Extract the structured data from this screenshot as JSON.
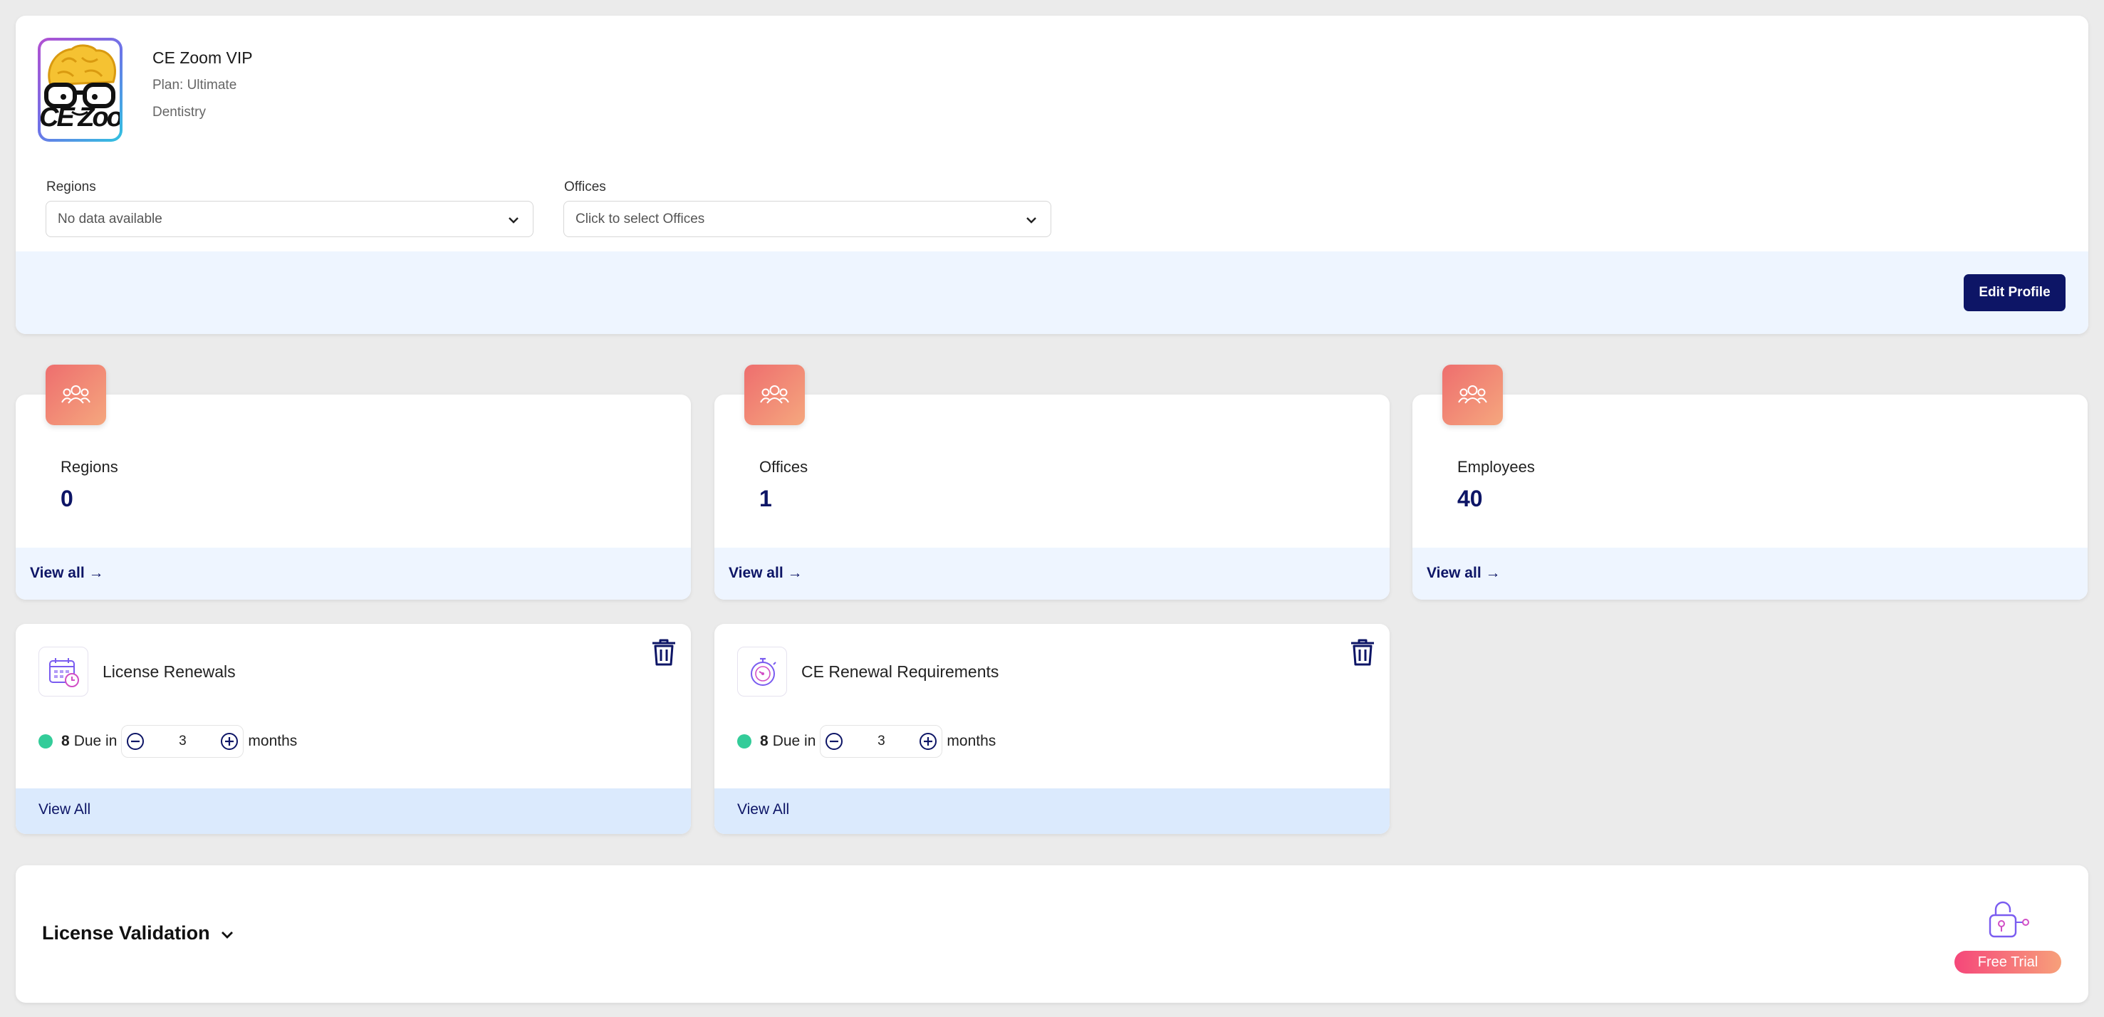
{
  "profile": {
    "name": "CE Zoom VIP",
    "plan": "Plan: Ultimate",
    "specialty": "Dentistry",
    "logo_text": "CE Zoon",
    "regions_label": "Regions",
    "regions_value": "No data available",
    "offices_label": "Offices",
    "offices_placeholder": "Click to select Offices",
    "edit_label": "Edit Profile"
  },
  "stats": [
    {
      "label": "Regions",
      "value": "0",
      "link": "View all →"
    },
    {
      "label": "Offices",
      "value": "1",
      "link": "View all →"
    },
    {
      "label": "Employees",
      "value": "40",
      "link": "View all →"
    }
  ],
  "renewals": [
    {
      "title": "License Renewals",
      "count": "8",
      "due_text": "Due in",
      "months": "3",
      "unit": "months",
      "footer": "View All"
    },
    {
      "title": "CE Renewal Requirements",
      "count": "8",
      "due_text": "Due in",
      "months": "3",
      "unit": "months",
      "footer": "View All"
    }
  ],
  "license_validation": {
    "title": "License Validation",
    "badge": "Free Trial"
  },
  "colors": {
    "accent": "#0d1566",
    "status_green": "#33cc99",
    "footer_tint": "#eef5ff",
    "stat_icon_gradient": [
      "#ee6e6e",
      "#f5a77e"
    ],
    "trial_gradient": [
      "#f5477a",
      "#f7a07a"
    ]
  }
}
